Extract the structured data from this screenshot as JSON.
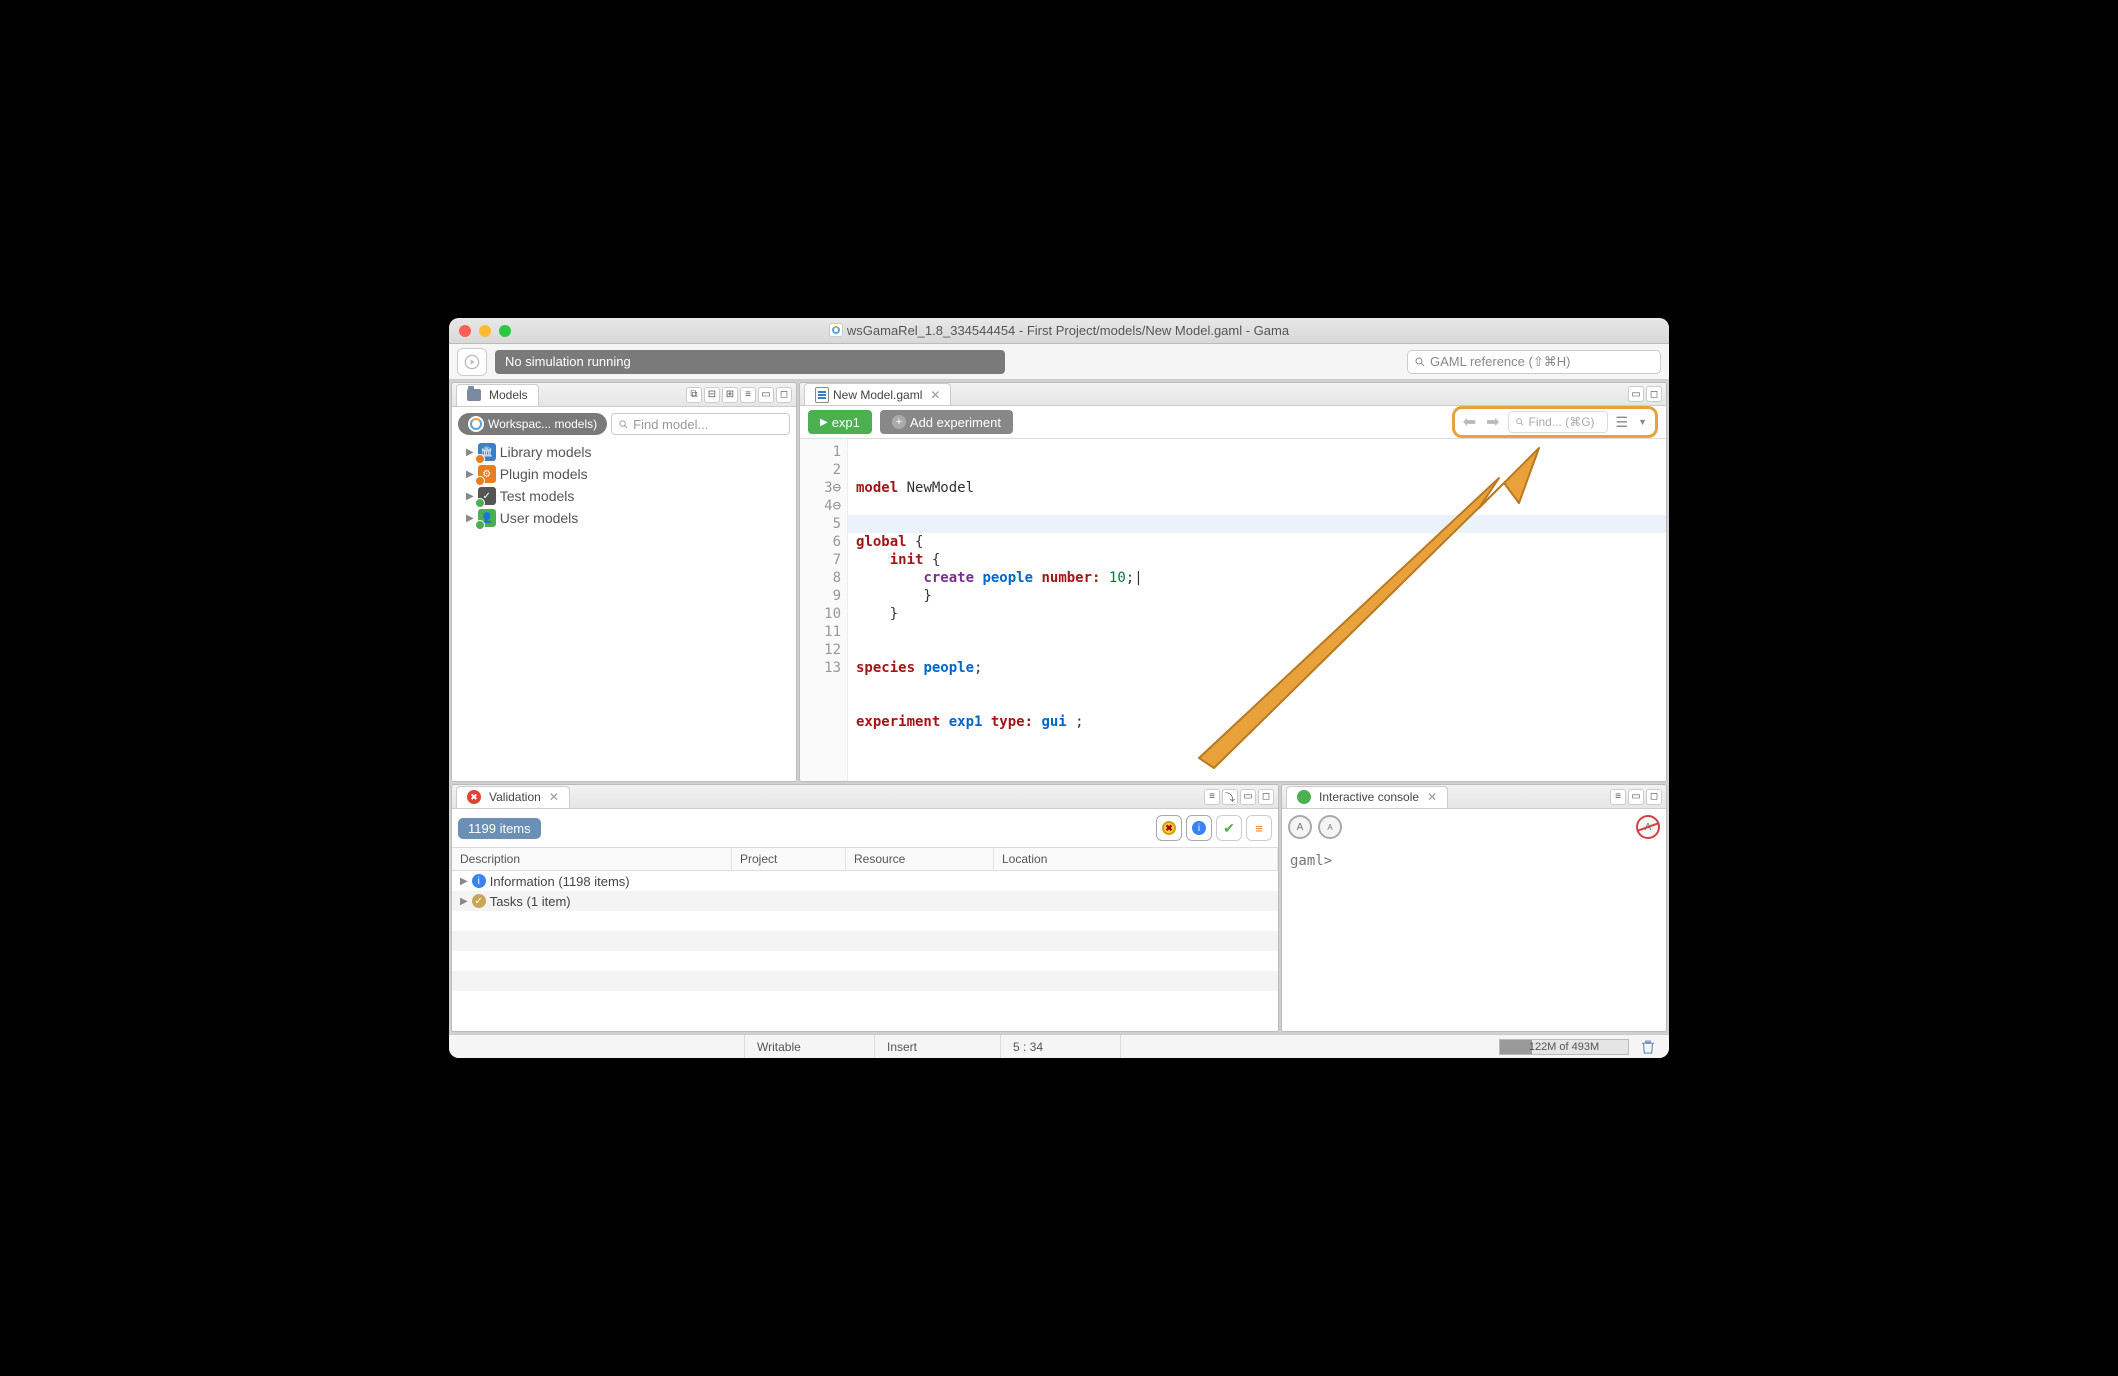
{
  "title": "wsGamaRel_1.8_334544454 - First Project/models/New Model.gaml - Gama",
  "toolbar": {
    "sim_status": "No simulation running",
    "search_placeholder": "GAML reference (⇧⌘H)"
  },
  "models": {
    "tab": "Models",
    "workspace_chip": "Workspac... models)",
    "find_placeholder": "Find model...",
    "items": [
      {
        "label": "Library models",
        "kind": "lib"
      },
      {
        "label": "Plugin models",
        "kind": "plugin"
      },
      {
        "label": "Test models",
        "kind": "test"
      },
      {
        "label": "User models",
        "kind": "user"
      }
    ]
  },
  "editor": {
    "tab": "New Model.gaml",
    "exp_button": "exp1",
    "add_exp": "Add experiment",
    "find_placeholder": "Find... (⌘G)",
    "lines": [
      "1",
      "2",
      "3",
      "4",
      "5",
      "6",
      "7",
      "8",
      "9",
      "10",
      "11",
      "12",
      "13"
    ],
    "code": {
      "l1_kw": "model",
      "l1_name": " NewModel",
      "l3_kw": "global",
      "l3_rest": " {",
      "l4_kw": "init",
      "l4_rest": " {",
      "l5_kw": "create ",
      "l5_id": "people",
      "l5_attr": " number:",
      "l5_num": " 10",
      "l5_end": ";|",
      "l6": "        }",
      "l7": "    }",
      "l9_kw": "species ",
      "l9_id": "people",
      "l9_end": ";",
      "l11_kw": "experiment ",
      "l11_id": "exp1",
      "l11_attr": " type:",
      "l11_val": " gui",
      "l11_end": " ;"
    }
  },
  "validation": {
    "tab": "Validation",
    "count": "1199 items",
    "headers": [
      "Description",
      "Project",
      "Resource",
      "Location"
    ],
    "rows": [
      {
        "icon": "info",
        "text": "Information (1198 items)"
      },
      {
        "icon": "task",
        "text": "Tasks (1 item)"
      }
    ]
  },
  "console": {
    "tab": "Interactive console",
    "prompt": "gaml>"
  },
  "status": {
    "writable": "Writable",
    "insert": "Insert",
    "pos": "5 : 34",
    "mem": "122M of 493M"
  }
}
